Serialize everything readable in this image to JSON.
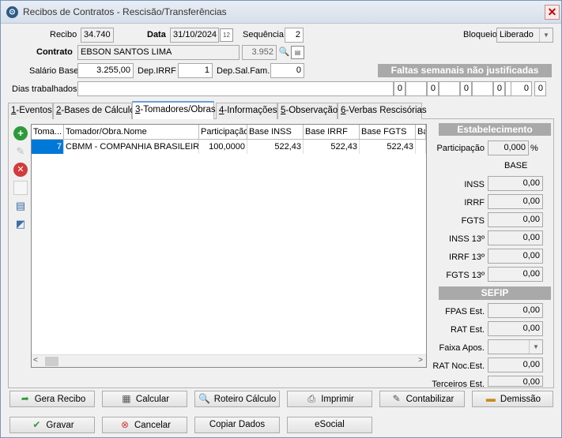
{
  "window": {
    "title": "Recibos de Contratos - Rescisão/Transferências",
    "close": "✕"
  },
  "header": {
    "recibo_label": "Recibo",
    "recibo_value": "34.740",
    "data_label": "Data",
    "data_value": "31/10/2024",
    "sequencia_label": "Sequência",
    "sequencia_value": "2",
    "bloqueio_label": "Bloqueio",
    "bloqueio_value": "Liberado",
    "contrato_label": "Contrato",
    "contrato_value": "EBSON SANTOS LIMA",
    "contrato_code": "3.952",
    "salario_label": "Salário Base",
    "salario_value": "3.255,00",
    "depirrf_label": "Dep.IRRF",
    "depirrf_value": "1",
    "depsalfam_label": "Dep.Sal.Fam.",
    "depsalfam_value": "0",
    "faltas_title": "Faltas semanais não justificadas",
    "dias_label": "Dias trabalhados",
    "faltas_values": [
      "0",
      "0",
      "0",
      "0",
      "0",
      "0"
    ]
  },
  "tabs": [
    {
      "key": "1",
      "label": "-Eventos"
    },
    {
      "key": "2",
      "label": "-Bases de Cálculo"
    },
    {
      "key": "3",
      "label": "-Tomadores/Obras"
    },
    {
      "key": "4",
      "label": "-Informações"
    },
    {
      "key": "5",
      "label": "-Observação"
    },
    {
      "key": "6",
      "label": "-Verbas Rescisórias"
    }
  ],
  "grid": {
    "columns": [
      "Toma...",
      "Tomador/Obra.Nome",
      "Participação",
      "Base INSS",
      "Base IRRF",
      "Base FGTS",
      "Ba"
    ],
    "rows": [
      [
        "7",
        "CBMM - COMPANHIA BRASILEIRA DE METALURGIA",
        "100,0000",
        "522,43",
        "522,43",
        "522,43",
        ""
      ]
    ]
  },
  "estabelecimento": {
    "title": "Estabelecimento",
    "participacao_label": "Participação",
    "participacao_value": "0,000",
    "participacao_unit": "%",
    "base_label": "BASE",
    "rows": [
      {
        "label": "INSS",
        "value": "0,00"
      },
      {
        "label": "IRRF",
        "value": "0,00"
      },
      {
        "label": "FGTS",
        "value": "0,00"
      },
      {
        "label": "INSS 13º",
        "value": "0,00"
      },
      {
        "label": "IRRF 13º",
        "value": "0,00"
      },
      {
        "label": "FGTS 13º",
        "value": "0,00"
      }
    ]
  },
  "sefip": {
    "title": "SEFIP",
    "fpas_label": "FPAS Est.",
    "fpas_value": "0,00",
    "rat_label": "RAT Est.",
    "rat_value": "0,00",
    "faixa_label": "Faixa Apos.",
    "faixa_value": "",
    "ratnoc_label": "RAT Noc.Est.",
    "ratnoc_value": "0,00",
    "terceiros_label": "Terceiros Est.",
    "terceiros_value": "0,00"
  },
  "buttons": {
    "gera_recibo": "Gera Recibo",
    "calcular": "Calcular",
    "roteiro": "Roteiro Cálculo",
    "imprimir": "Imprimir",
    "contabilizar": "Contabilizar",
    "demissao": "Demissão",
    "gravar": "Gravar",
    "cancelar": "Cancelar",
    "copiar": "Copiar Dados",
    "esocial": "eSocial"
  }
}
